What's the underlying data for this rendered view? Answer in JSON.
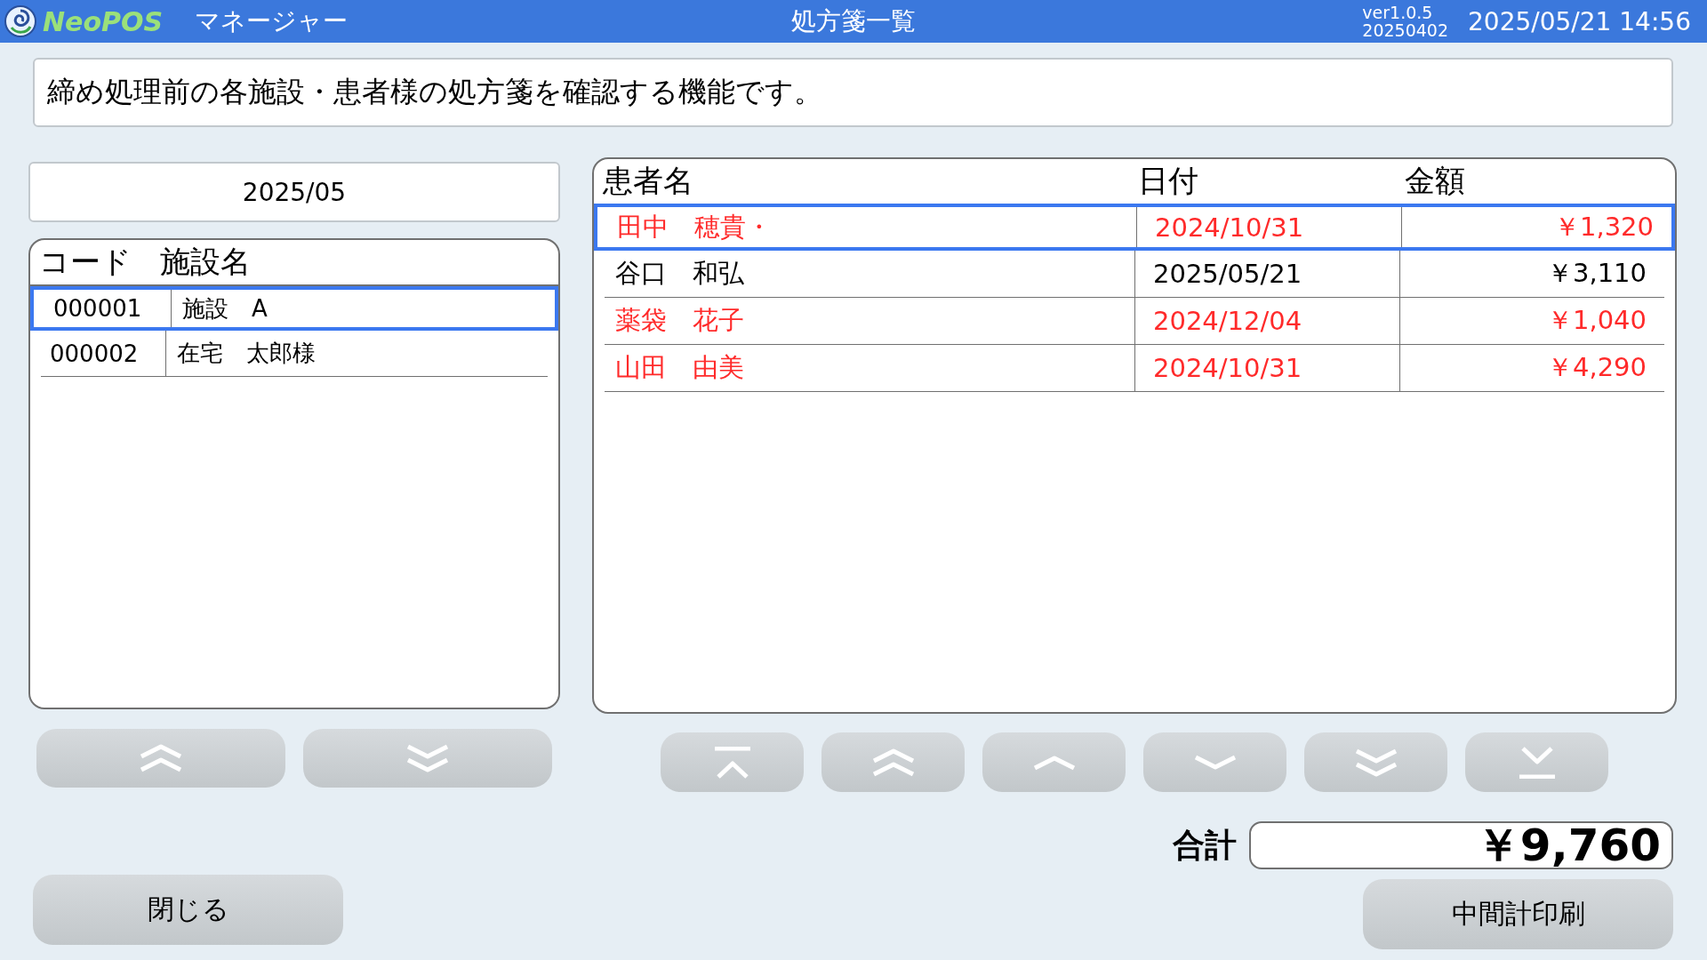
{
  "header": {
    "logo": "NeoPOS",
    "role": "マネージャー",
    "title": "処方箋一覧",
    "version": "ver1.0.5",
    "build": "20250402",
    "datetime": "2025/05/21 14:56"
  },
  "message": "締め処理前の各施設・患者様の処方箋を確認する機能です。",
  "month": "2025/05",
  "facility_table": {
    "columns": [
      "コード",
      "施設名"
    ],
    "rows": [
      {
        "code": "000001",
        "name": "施設　A",
        "selected": true
      },
      {
        "code": "000002",
        "name": "在宅　太郎様",
        "selected": false
      }
    ]
  },
  "facility_nav": [
    {
      "kind": "page-up"
    },
    {
      "kind": "page-down"
    }
  ],
  "patient_table": {
    "columns": [
      "患者名",
      "日付",
      "金額"
    ],
    "rows": [
      {
        "name": "田中　穂貴・",
        "date": "2024/10/31",
        "amount": "￥1,320",
        "color": "#ff2a2a",
        "selected": true
      },
      {
        "name": "谷口　和弘",
        "date": "2025/05/21",
        "amount": "￥3,110",
        "color": "#000000",
        "selected": false
      },
      {
        "name": "薬袋　花子",
        "date": "2024/12/04",
        "amount": "￥1,040",
        "color": "#ff2a2a",
        "selected": false
      },
      {
        "name": "山田　由美",
        "date": "2024/10/31",
        "amount": "￥4,290",
        "color": "#ff2a2a",
        "selected": false
      }
    ]
  },
  "patient_nav": [
    {
      "kind": "top"
    },
    {
      "kind": "page-up"
    },
    {
      "kind": "up"
    },
    {
      "kind": "down"
    },
    {
      "kind": "page-down"
    },
    {
      "kind": "bottom"
    }
  ],
  "total": {
    "label": "合計",
    "value": "￥9,760"
  },
  "close_button": "閉じる",
  "print_button": "中間計印刷"
}
